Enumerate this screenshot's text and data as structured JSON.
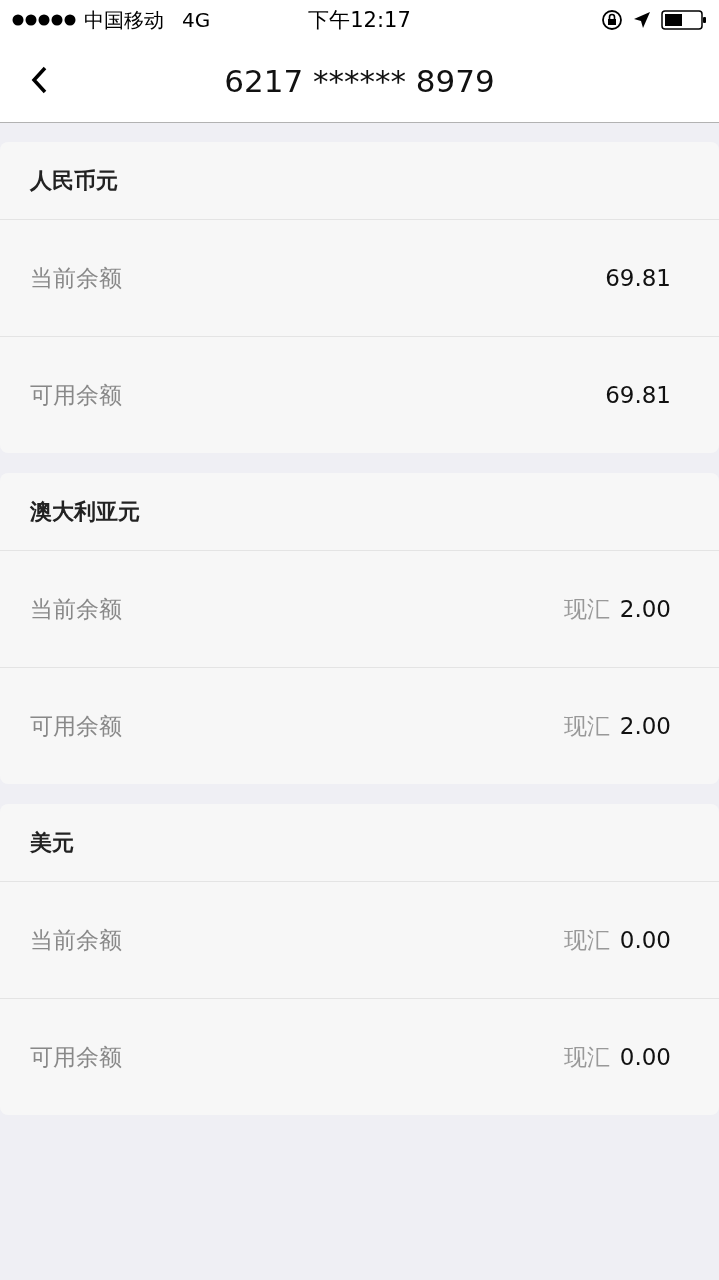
{
  "status_bar": {
    "carrier": "中国移动",
    "network": "4G",
    "time": "下午12:17"
  },
  "nav": {
    "title": "6217 ****** 8979"
  },
  "sections": [
    {
      "currency": "人民币元",
      "rows": [
        {
          "label": "当前余额",
          "value": "69.81"
        },
        {
          "label": "可用余额",
          "value": "69.81"
        }
      ]
    },
    {
      "currency": "澳大利亚元",
      "rows": [
        {
          "label": "当前余额",
          "tag": "现汇",
          "value": "2.00"
        },
        {
          "label": "可用余额",
          "tag": "现汇",
          "value": "2.00"
        }
      ]
    },
    {
      "currency": "美元",
      "rows": [
        {
          "label": "当前余额",
          "tag": "现汇",
          "value": "0.00"
        },
        {
          "label": "可用余额",
          "tag": "现汇",
          "value": "0.00"
        }
      ]
    }
  ]
}
